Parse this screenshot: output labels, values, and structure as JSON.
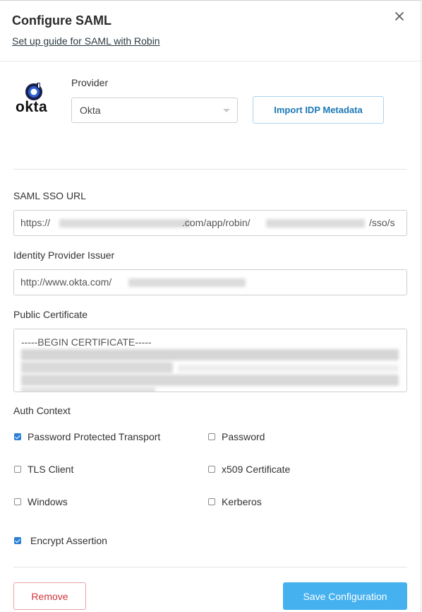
{
  "header": {
    "title": "Configure SAML",
    "guide_link": "Set up guide for SAML with Robin",
    "close_icon": "close-icon"
  },
  "provider": {
    "logo_text": "okta",
    "label": "Provider",
    "selected": "Okta",
    "import_button": "Import IDP Metadata"
  },
  "sso_url": {
    "label": "SAML SSO URL",
    "value_start": "https://",
    "value_mid": ".com/app/robin/",
    "value_end": "/sso/s"
  },
  "issuer": {
    "label": "Identity Provider Issuer",
    "value": "http://www.okta.com/"
  },
  "certificate": {
    "label": "Public Certificate",
    "first_line": "-----BEGIN CERTIFICATE-----"
  },
  "auth_context": {
    "label": "Auth Context",
    "options": [
      {
        "label": "Password Protected Transport",
        "checked": true
      },
      {
        "label": "Password",
        "checked": false
      },
      {
        "label": "TLS Client",
        "checked": false
      },
      {
        "label": "x509 Certificate",
        "checked": false
      },
      {
        "label": "Windows",
        "checked": false
      },
      {
        "label": "Kerberos",
        "checked": false
      }
    ]
  },
  "encrypt_assertion": {
    "label": "Encrypt Assertion",
    "checked": true
  },
  "footer": {
    "remove_button": "Remove",
    "save_button": "Save Configuration"
  },
  "colors": {
    "primary": "#45b1ee",
    "danger": "#d1363c",
    "checkbox": "#2b7fd6",
    "okta_blue": "#1c78b6"
  }
}
